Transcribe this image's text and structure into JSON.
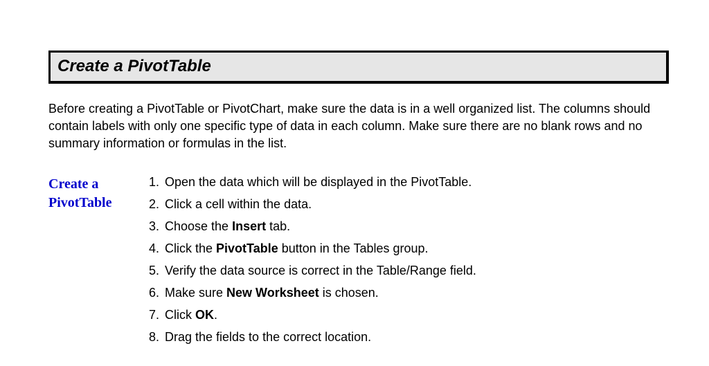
{
  "heading": "Create a PivotTable",
  "intro": "Before creating a PivotTable or PivotChart, make sure the data is in a well organized list.  The columns should contain labels with only one specific type of data in each column.  Make sure there are no blank rows and no summary information or formulas in the list.",
  "sidebar_line1": "Create a",
  "sidebar_line2": "PivotTable",
  "steps": [
    {
      "num": "1.",
      "html": "Open the data which will be displayed in the PivotTable."
    },
    {
      "num": "2.",
      "html": "Click a cell within the data."
    },
    {
      "num": "3.",
      "html": "Choose the <b>Insert</b> tab."
    },
    {
      "num": "4.",
      "html": "Click the <b>PivotTable</b> button in the Tables group."
    },
    {
      "num": "5.",
      "html": "Verify the data source is correct in the Table/Range field."
    },
    {
      "num": "6.",
      "html": "Make sure <b>New Worksheet</b> is chosen."
    },
    {
      "num": "7.",
      "html": "Click <b>OK</b>."
    },
    {
      "num": "8.",
      "html": "Drag the fields to the correct location."
    }
  ]
}
